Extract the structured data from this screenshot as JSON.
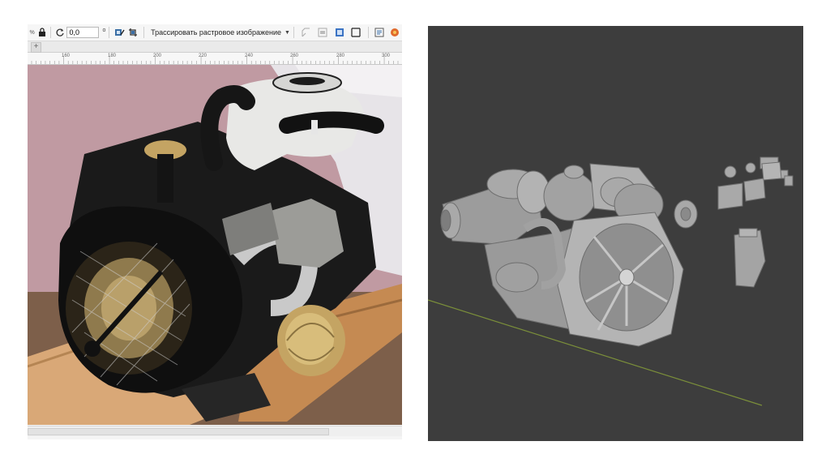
{
  "editor": {
    "toolbar": {
      "percent_symbol": "%",
      "rotation_value": "0,0",
      "degree_symbol": "o",
      "trace_bitmap_label": "Трассировать растровое изображение",
      "icons": [
        "lock-ratio-icon",
        "rotate-icon",
        "edit-bitmap-icon",
        "crop-bitmap-icon",
        "dropdown-caret-icon",
        "outline-frame-icon",
        "align-icon",
        "selection-frame-icon",
        "frame-icon",
        "document-icon",
        "color-icon"
      ]
    },
    "add_button_label": "+",
    "ruler_ticks": [
      "160",
      "180",
      "200",
      "220",
      "240",
      "260",
      "280",
      "300"
    ],
    "photo": {
      "subject": "engine-photo",
      "colors": {
        "wall": "#c09aa2",
        "floor": "#7d5f4a",
        "pallet": "#d9a877",
        "engine_black": "#141414",
        "aluminium": "#c9c9c9",
        "shroud_white": "#e8e8e6",
        "brass": "#c4a463"
      }
    }
  },
  "viewport": {
    "background": "#3d3d3d",
    "model_color": "#a9a9a9",
    "grid_line_color": "#7b8f3a",
    "model": "engine-3d-model"
  }
}
